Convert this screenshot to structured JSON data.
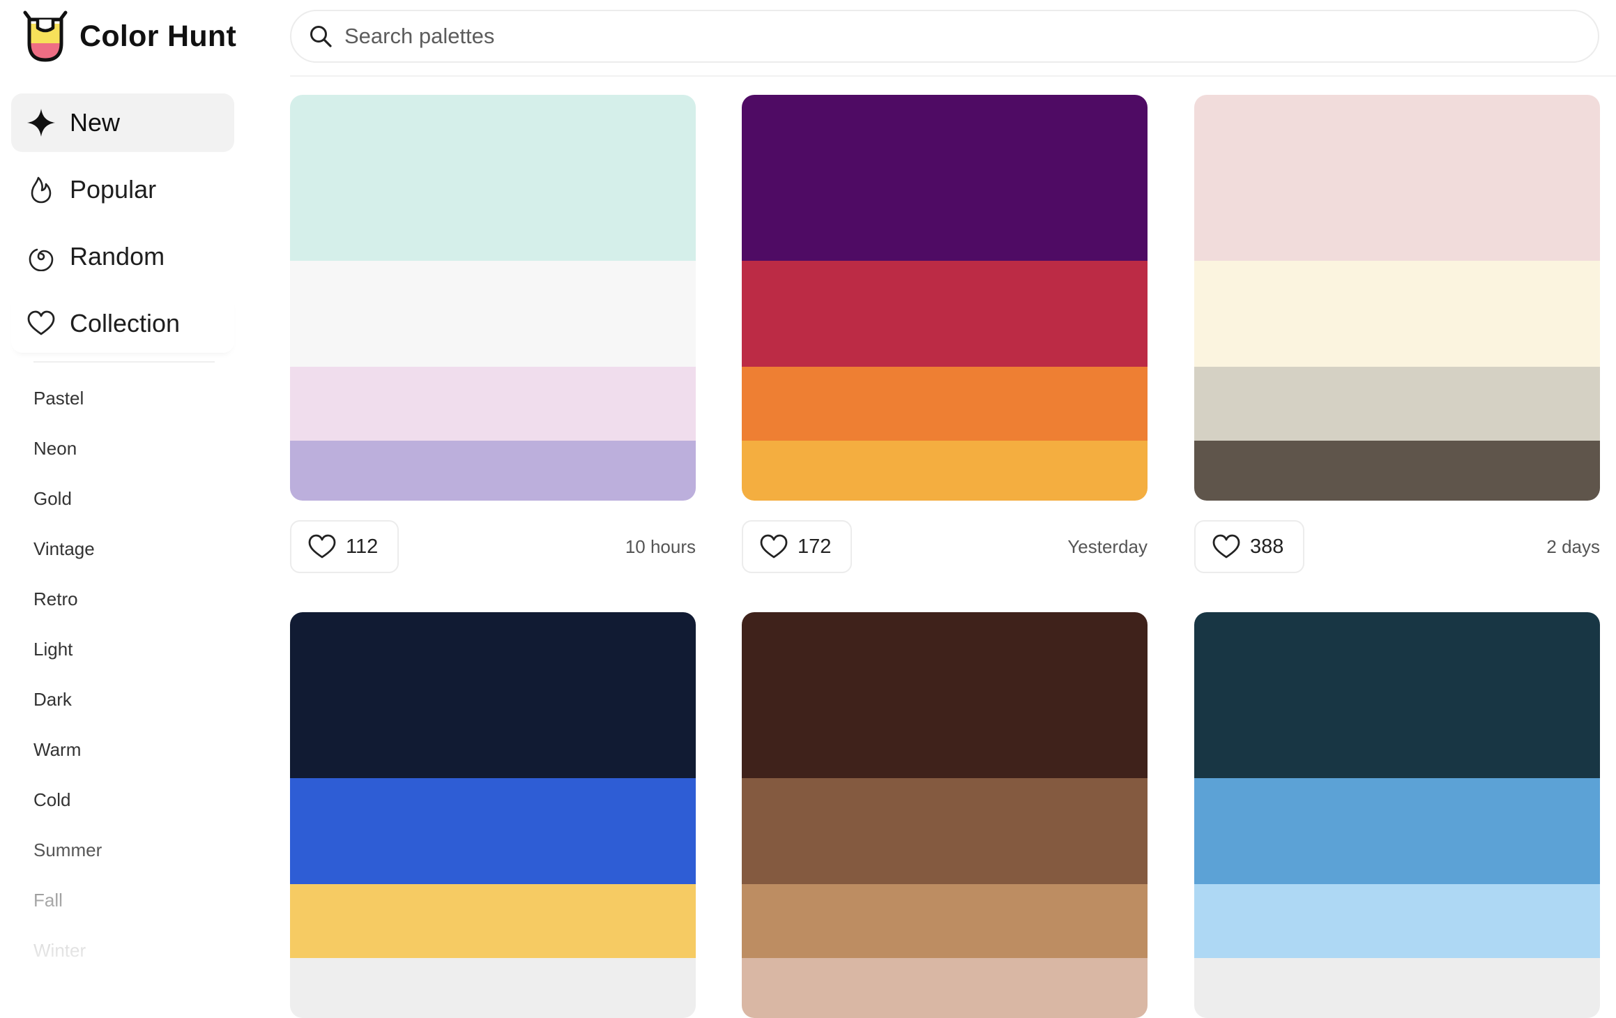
{
  "app": {
    "name": "Color Hunt"
  },
  "search": {
    "placeholder": "Search palettes",
    "value": ""
  },
  "sidebar": {
    "nav": [
      {
        "label": "New",
        "icon": "sparkle-icon",
        "active": true
      },
      {
        "label": "Popular",
        "icon": "flame-icon",
        "active": false
      },
      {
        "label": "Random",
        "icon": "spiral-icon",
        "active": false
      },
      {
        "label": "Collection",
        "icon": "heart-icon",
        "active": false
      }
    ],
    "tags": [
      "Pastel",
      "Neon",
      "Gold",
      "Vintage",
      "Retro",
      "Light",
      "Dark",
      "Warm",
      "Cold",
      "Summer",
      "Fall",
      "Winter"
    ]
  },
  "palettes": [
    {
      "colors": [
        "#D5EFEA",
        "#F7F7F7",
        "#F0DDED",
        "#BCAFDC"
      ],
      "likes": "112",
      "time": "10 hours"
    },
    {
      "colors": [
        "#4F0B64",
        "#BC2B45",
        "#EE7F33",
        "#F4AE40"
      ],
      "likes": "172",
      "time": "Yesterday"
    },
    {
      "colors": [
        "#F1DCDB",
        "#FBF4DF",
        "#D5D1C4",
        "#5F554B"
      ],
      "likes": "388",
      "time": "2 days"
    },
    {
      "colors": [
        "#111B33",
        "#2E5DD5",
        "#F6CB63",
        "#EEEEEE"
      ],
      "likes": "",
      "time": ""
    },
    {
      "colors": [
        "#3F221B",
        "#845A40",
        "#BD8D62",
        "#D9B7A4"
      ],
      "likes": "",
      "time": ""
    },
    {
      "colors": [
        "#183644",
        "#5CA2D6",
        "#AED8F4",
        "#EDEDED"
      ],
      "likes": "",
      "time": ""
    }
  ],
  "colors": {
    "logo_yellow": "#F7E15A",
    "logo_pink": "#EE6E84",
    "logo_outline": "#111111",
    "active_bg": "#F2F2F2",
    "border": "#ECECEC"
  }
}
